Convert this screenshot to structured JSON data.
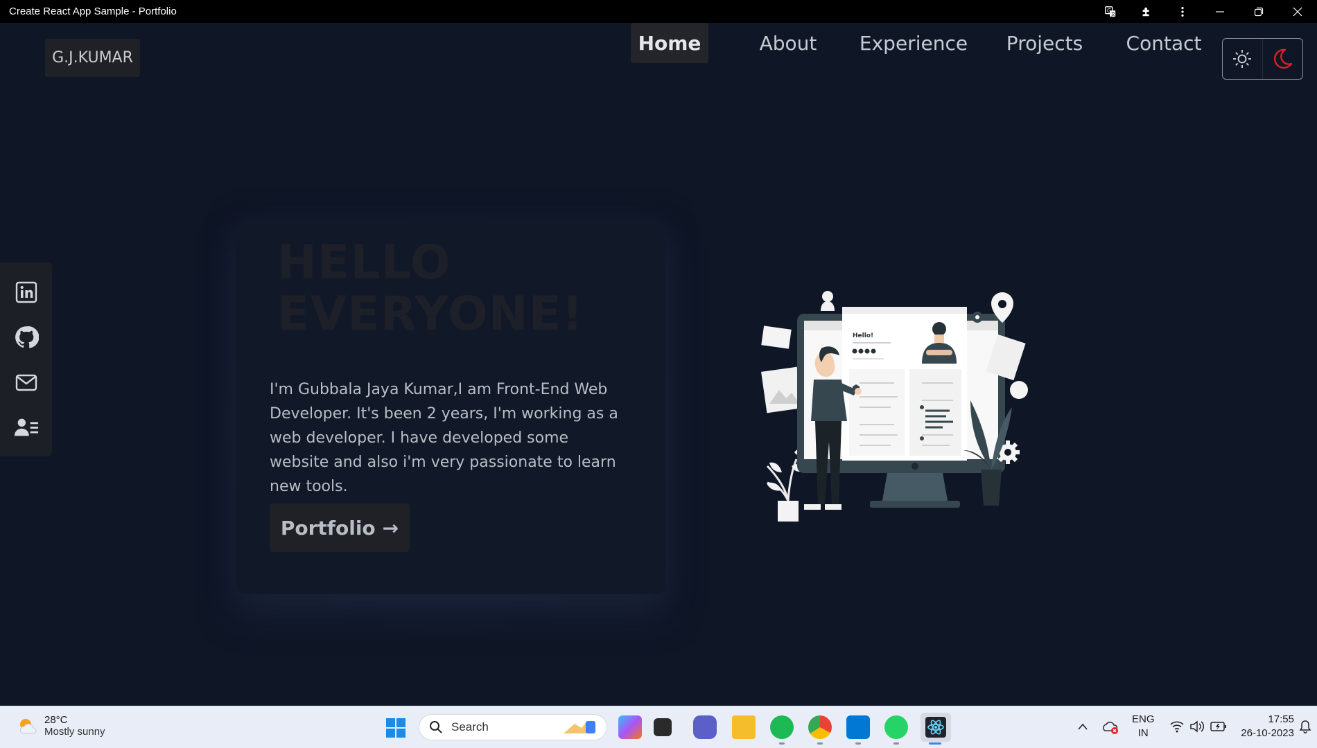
{
  "window": {
    "title": "Create React App Sample - Portfolio"
  },
  "nav": {
    "logo": "G.J.KUMAR",
    "items": [
      {
        "label": "Home",
        "active": true
      },
      {
        "label": "About",
        "active": false
      },
      {
        "label": "Experience",
        "active": false
      },
      {
        "label": "Projects",
        "active": false
      },
      {
        "label": "Contact",
        "active": false
      }
    ],
    "theme": {
      "light_icon": "sun-icon",
      "dark_icon": "moon-icon",
      "dark_color": "#e11d2a"
    }
  },
  "social": [
    "linkedin-icon",
    "github-icon",
    "mail-icon",
    "contact-card-icon"
  ],
  "hero": {
    "title_line1": "HELLO",
    "title_line2": "EVERYONE!",
    "description": "I'm Gubbala Jaya Kumar,I am Front-End Web Developer. It's been 2 years, I'm working as a web developer. I have developed some website and also i'm very passionate to learn new tools.",
    "button_label": "Portfolio",
    "button_arrow": "→"
  },
  "illustration": {
    "greeting": "Hello!"
  },
  "taskbar": {
    "weather": {
      "temp": "28°C",
      "condition": "Mostly sunny"
    },
    "search_placeholder": "Search",
    "lang_line1": "ENG",
    "lang_line2": "IN",
    "time": "17:55",
    "date": "26-10-2023"
  },
  "colors": {
    "page_bg": "#0f1626",
    "card_bg": "#111827",
    "accent_red": "#e11d2a",
    "button_bg": "#1f2126"
  }
}
